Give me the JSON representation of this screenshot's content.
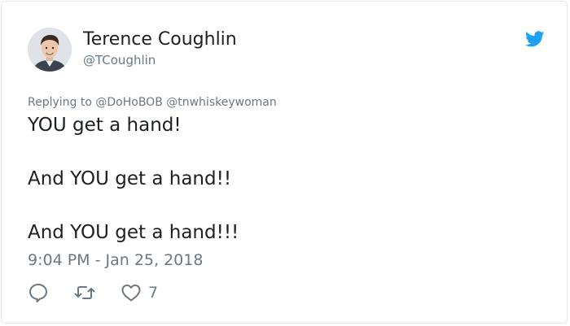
{
  "author": {
    "display_name": "Terence Coughlin",
    "handle": "@TCoughlin"
  },
  "replying_to": "Replying to @DoHoBOB @tnwhiskeywoman",
  "tweet": {
    "lines": [
      "YOU get a hand!",
      "And YOU get a hand!!",
      "And YOU get a hand!!!"
    ],
    "timestamp": "9:04 PM - Jan 25, 2018"
  },
  "actions": {
    "like_count": "7"
  },
  "icons": {
    "brand": "twitter-bird-icon",
    "reply": "reply-icon",
    "retweet": "retweet-icon",
    "like": "heart-icon"
  },
  "colors": {
    "brand_blue": "#1da1f2",
    "text_primary": "#1c2022",
    "text_secondary": "#697882",
    "border": "#e1e8ed"
  }
}
